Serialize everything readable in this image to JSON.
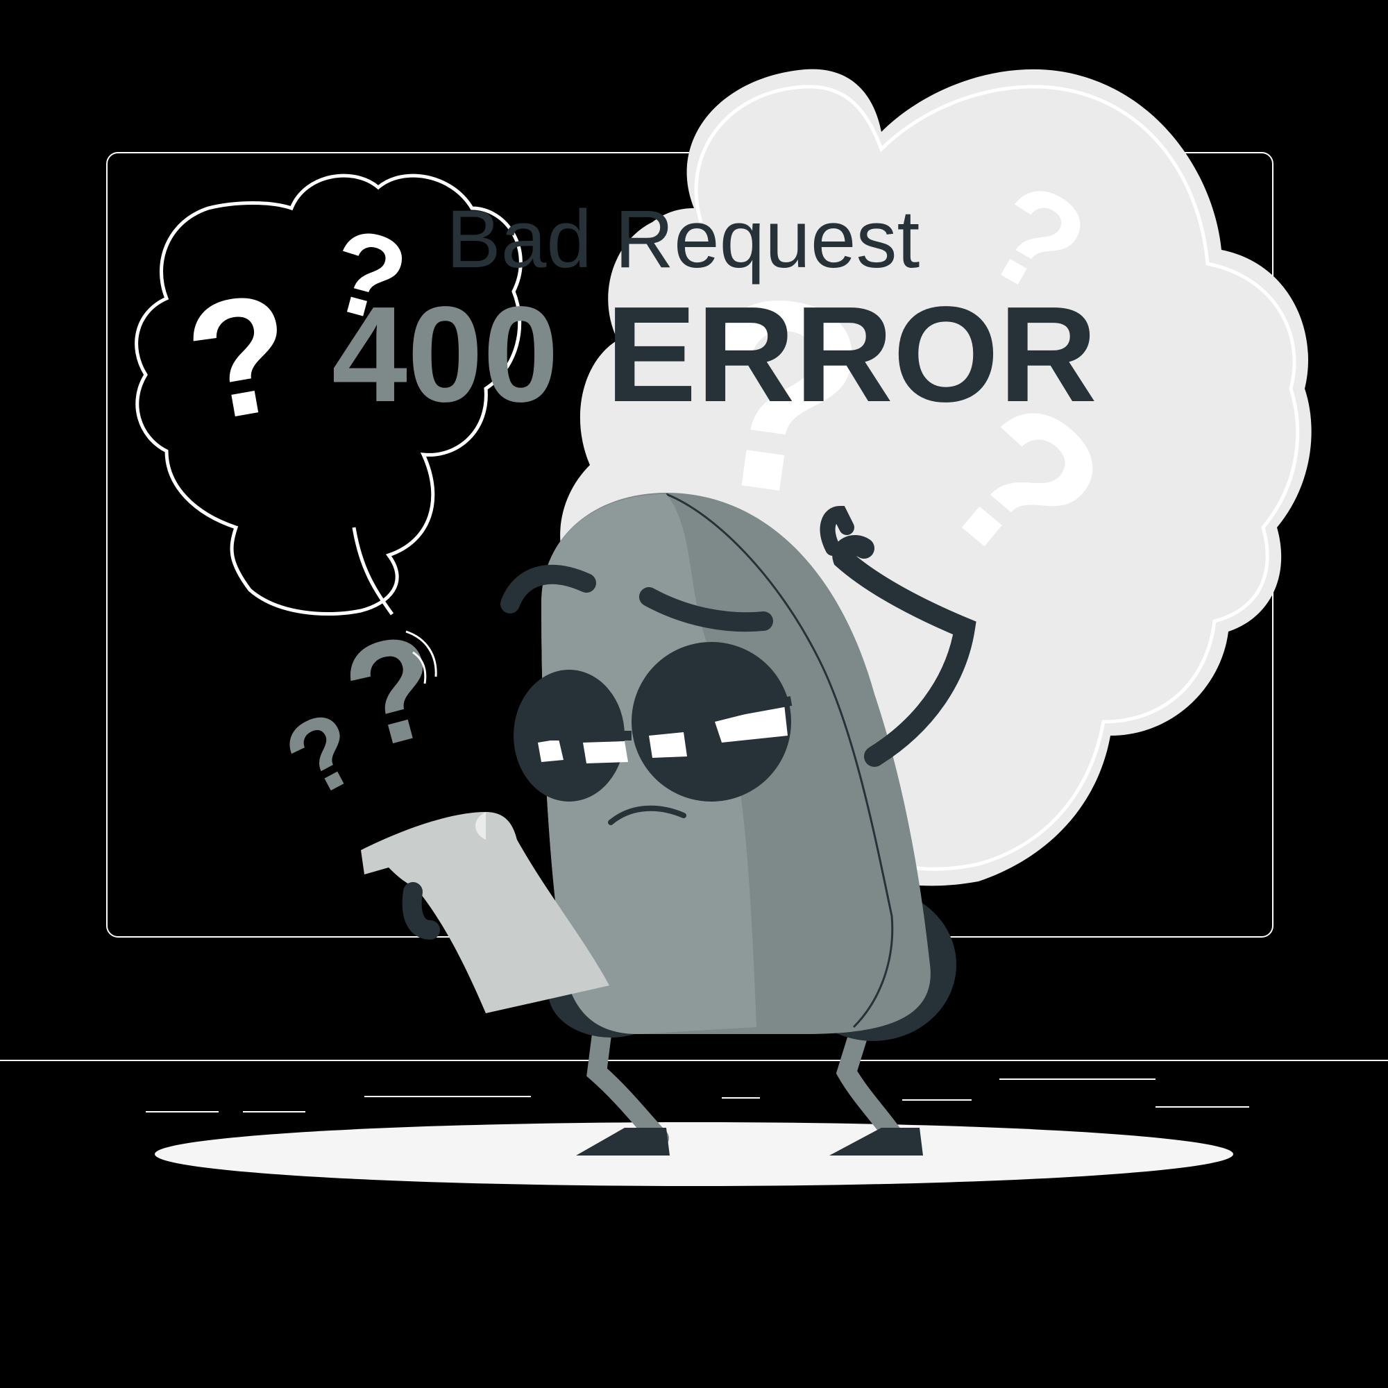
{
  "illustration": {
    "subtitle": "Bad Request",
    "code": "400",
    "label": "ERROR",
    "colors": {
      "background": "#000000",
      "dark": "#263238",
      "body_gray": "#7E8A89",
      "body_light": "#8E9999",
      "cloud_light": "#EBEBEB",
      "white": "#FFFFFF",
      "paper": "#C9CECD"
    },
    "icons": [
      "question-mark-icon",
      "thought-cloud",
      "speech-bubble",
      "confused-character"
    ]
  }
}
